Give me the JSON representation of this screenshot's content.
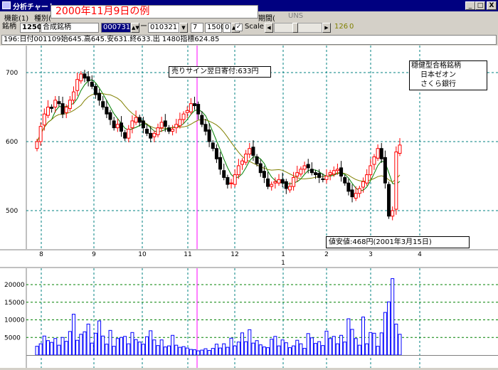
{
  "window": {
    "title": "分析チャート",
    "min": "_",
    "max": "□",
    "close": "X"
  },
  "overlay_title": "2000年11月9日の例",
  "menu": {
    "items": [
      "機能(1)",
      "種別(",
      "期間(",
      "UNS"
    ]
  },
  "toolbar": {
    "code_label": "銘柄",
    "code": "1250",
    "name": "合成銘柄",
    "from_date": "000731",
    "dash": "ー",
    "to_date": "010321",
    "field1": "7",
    "field2": "1500",
    "field3": "0",
    "scale_check": "✓",
    "scale_label": "Scale",
    "val1": "126",
    "val2": "0"
  },
  "infobar": "196:日付001109始645.高645.安631.終633.出 1480指標624.85",
  "legend": {
    "line1": "穏健型合格銘柄",
    "line2": "日本ゼオン",
    "line3": "さくら銀行"
  },
  "annotations": {
    "sell": "売りサイン翌日寄付:633円",
    "low": "値安値:468円(2001年3月15日)"
  },
  "price_axis": [
    "700",
    "600",
    "500"
  ],
  "months": [
    "8",
    "9",
    "10",
    "11",
    "12",
    "1",
    "2",
    "3",
    "4"
  ],
  "year_marker": "1",
  "volume_axis": [
    "20000",
    "15000",
    "10000",
    "5000"
  ],
  "colors": {
    "up": "#ff0000",
    "down": "#000000",
    "ma1": "#008000",
    "ma2": "#808000",
    "vline": "#ff00ff",
    "volume": "#0000ff",
    "grid": "#008080"
  },
  "chart_data": {
    "type": "candlestick",
    "close_prices": [
      600,
      622,
      640,
      650,
      648,
      660,
      655,
      640,
      650,
      660,
      672,
      690,
      698,
      692,
      688,
      680,
      668,
      660,
      650,
      640,
      632,
      620,
      625,
      615,
      605,
      618,
      630,
      635,
      628,
      620,
      612,
      605,
      612,
      620,
      628,
      622,
      615,
      618,
      625,
      632,
      640,
      645,
      655,
      652,
      640,
      625,
      615,
      600,
      590,
      575,
      560,
      548,
      538,
      540,
      552,
      565,
      572,
      582,
      590,
      580,
      568,
      555,
      548,
      535,
      538,
      542,
      545,
      540,
      532,
      535,
      548,
      555,
      560,
      565,
      562,
      555,
      552,
      548,
      545,
      550,
      555,
      558,
      560,
      550,
      540,
      528,
      520,
      525,
      532,
      542,
      552,
      565,
      578,
      590,
      575,
      540,
      492,
      500,
      585,
      595
    ],
    "volumes": [
      2500,
      3200,
      5400,
      4100,
      3600,
      4700,
      2800,
      5000,
      3900,
      6700,
      11600,
      4200,
      5900,
      6600,
      8800,
      3400,
      6200,
      9700,
      5400,
      3100,
      7000,
      2500,
      4700,
      5000,
      5300,
      3200,
      6400,
      4400,
      3700,
      3100,
      5200,
      6900,
      4300,
      2700,
      4300,
      2300,
      2600,
      5600,
      2800,
      2200,
      2400,
      2000,
      1600,
      1500,
      1200,
      1400,
      1800,
      1300,
      1900,
      3100,
      2000,
      3200,
      2200,
      4800,
      2600,
      3700,
      6300,
      3800,
      7200,
      3400,
      4100,
      2900,
      2300,
      2100,
      4500,
      5300,
      2600,
      4300,
      3500,
      2100,
      2600,
      4200,
      3200,
      1900,
      6100,
      4900,
      3300,
      3800,
      2700,
      6800,
      4700,
      5300,
      3200,
      5600,
      3700,
      10300,
      7300,
      4700,
      2800,
      10800,
      3200,
      6400,
      6200,
      2500,
      6300,
      12100,
      15100,
      21700,
      8800,
      5900
    ],
    "price_ticks": [
      700,
      600,
      500
    ],
    "volume_ticks": [
      20000,
      15000,
      10000,
      5000
    ],
    "x_ticks": [
      "8",
      "9",
      "10",
      "11",
      "12",
      "1",
      "2",
      "3",
      "4"
    ],
    "price_range": [
      460,
      720
    ],
    "volume_range": [
      0,
      24000
    ],
    "grid": true
  }
}
